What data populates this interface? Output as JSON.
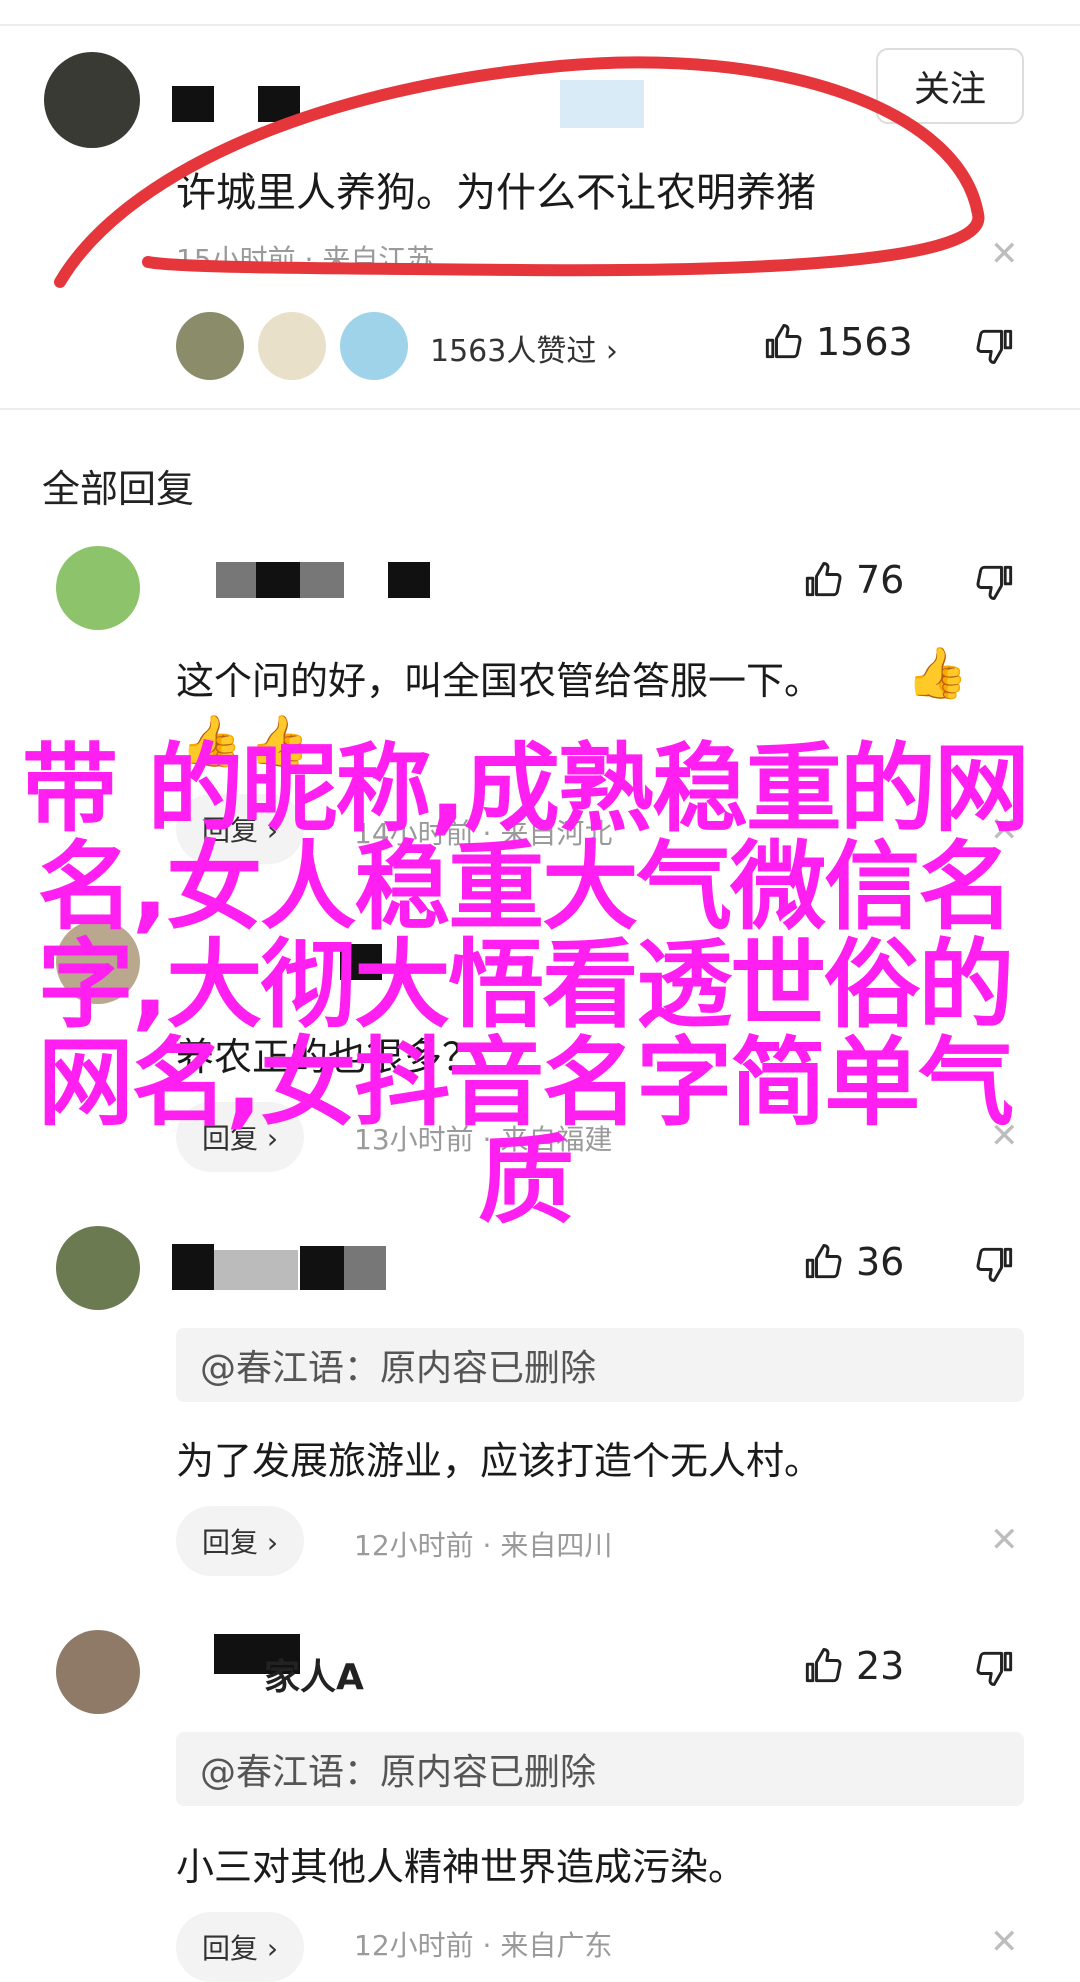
{
  "op": {
    "follow_label": "关注",
    "content": "许城里人养狗。为什么不让农明养猪",
    "meta": "15小时前 · 来自江苏",
    "likers_text": "1563人赞过 ›",
    "like_count": "1563",
    "annotation_color": "#e5363c"
  },
  "section_title": "全部回复",
  "replies": [
    {
      "like_count": "76",
      "content": "这个问的好，叫全国农管给答服一下。",
      "reply_label": "回复 ›",
      "meta": "14小时前 · 来自河北"
    },
    {
      "name": "",
      "content": "养农正的也很多？",
      "reply_label": "回复 ›",
      "meta": "13小时前 · 来自福建"
    },
    {
      "like_count": "36",
      "quote": "@春江语：原内容已删除",
      "content": "为了发展旅游业，应该打造个无人村。",
      "reply_label": "回复 ›",
      "meta": "12小时前 · 来自四川"
    },
    {
      "name": "家人A",
      "like_count": "23",
      "quote": "@春江语：原内容已删除",
      "content": "小三对其他人精神世界造成污染。",
      "reply_label": "回复 ›",
      "meta": "12小时前 · 来自广东"
    }
  ],
  "overlay_text": "带 的昵称,成熟稳重的网名,女人稳重大气微信名字,大彻大悟看透世俗的网名,女抖音名字简单气质",
  "colors": {
    "overlay": "#ff1ff0",
    "accent_red": "#e5363c"
  }
}
